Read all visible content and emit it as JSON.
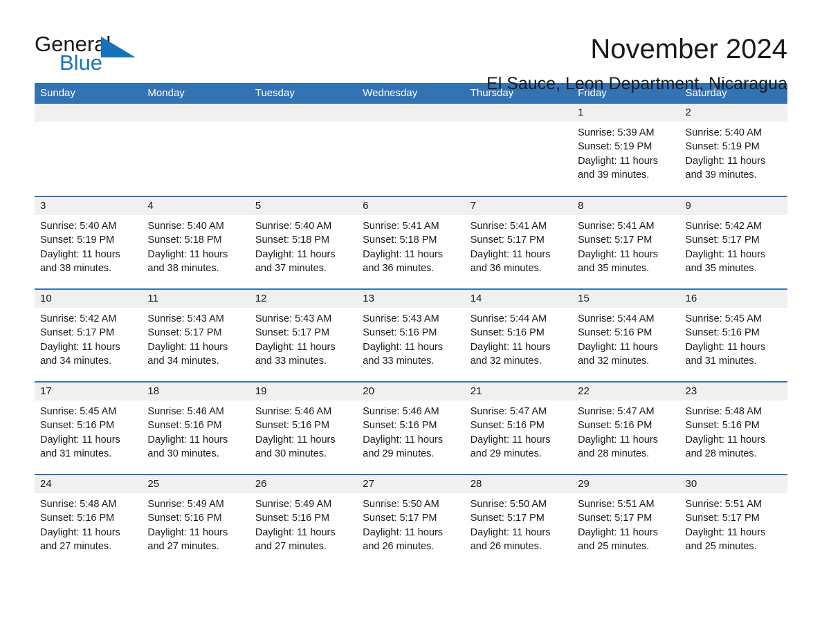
{
  "brand": {
    "name_part1": "General",
    "name_part2": "Blue",
    "triangle_color": "#1474bb",
    "accent_color": "#3273b4"
  },
  "header": {
    "month_title": "November 2024",
    "location": "El Sauce, Leon Department, Nicaragua"
  },
  "weekday_headers": [
    "Sunday",
    "Monday",
    "Tuesday",
    "Wednesday",
    "Thursday",
    "Friday",
    "Saturday"
  ],
  "weeks": [
    [
      {
        "day": "",
        "sunrise": "",
        "sunset": "",
        "daylight_line1": "",
        "daylight_line2": ""
      },
      {
        "day": "",
        "sunrise": "",
        "sunset": "",
        "daylight_line1": "",
        "daylight_line2": ""
      },
      {
        "day": "",
        "sunrise": "",
        "sunset": "",
        "daylight_line1": "",
        "daylight_line2": ""
      },
      {
        "day": "",
        "sunrise": "",
        "sunset": "",
        "daylight_line1": "",
        "daylight_line2": ""
      },
      {
        "day": "",
        "sunrise": "",
        "sunset": "",
        "daylight_line1": "",
        "daylight_line2": ""
      },
      {
        "day": "1",
        "sunrise": "Sunrise: 5:39 AM",
        "sunset": "Sunset: 5:19 PM",
        "daylight_line1": "Daylight: 11 hours",
        "daylight_line2": "and 39 minutes."
      },
      {
        "day": "2",
        "sunrise": "Sunrise: 5:40 AM",
        "sunset": "Sunset: 5:19 PM",
        "daylight_line1": "Daylight: 11 hours",
        "daylight_line2": "and 39 minutes."
      }
    ],
    [
      {
        "day": "3",
        "sunrise": "Sunrise: 5:40 AM",
        "sunset": "Sunset: 5:19 PM",
        "daylight_line1": "Daylight: 11 hours",
        "daylight_line2": "and 38 minutes."
      },
      {
        "day": "4",
        "sunrise": "Sunrise: 5:40 AM",
        "sunset": "Sunset: 5:18 PM",
        "daylight_line1": "Daylight: 11 hours",
        "daylight_line2": "and 38 minutes."
      },
      {
        "day": "5",
        "sunrise": "Sunrise: 5:40 AM",
        "sunset": "Sunset: 5:18 PM",
        "daylight_line1": "Daylight: 11 hours",
        "daylight_line2": "and 37 minutes."
      },
      {
        "day": "6",
        "sunrise": "Sunrise: 5:41 AM",
        "sunset": "Sunset: 5:18 PM",
        "daylight_line1": "Daylight: 11 hours",
        "daylight_line2": "and 36 minutes."
      },
      {
        "day": "7",
        "sunrise": "Sunrise: 5:41 AM",
        "sunset": "Sunset: 5:17 PM",
        "daylight_line1": "Daylight: 11 hours",
        "daylight_line2": "and 36 minutes."
      },
      {
        "day": "8",
        "sunrise": "Sunrise: 5:41 AM",
        "sunset": "Sunset: 5:17 PM",
        "daylight_line1": "Daylight: 11 hours",
        "daylight_line2": "and 35 minutes."
      },
      {
        "day": "9",
        "sunrise": "Sunrise: 5:42 AM",
        "sunset": "Sunset: 5:17 PM",
        "daylight_line1": "Daylight: 11 hours",
        "daylight_line2": "and 35 minutes."
      }
    ],
    [
      {
        "day": "10",
        "sunrise": "Sunrise: 5:42 AM",
        "sunset": "Sunset: 5:17 PM",
        "daylight_line1": "Daylight: 11 hours",
        "daylight_line2": "and 34 minutes."
      },
      {
        "day": "11",
        "sunrise": "Sunrise: 5:43 AM",
        "sunset": "Sunset: 5:17 PM",
        "daylight_line1": "Daylight: 11 hours",
        "daylight_line2": "and 34 minutes."
      },
      {
        "day": "12",
        "sunrise": "Sunrise: 5:43 AM",
        "sunset": "Sunset: 5:17 PM",
        "daylight_line1": "Daylight: 11 hours",
        "daylight_line2": "and 33 minutes."
      },
      {
        "day": "13",
        "sunrise": "Sunrise: 5:43 AM",
        "sunset": "Sunset: 5:16 PM",
        "daylight_line1": "Daylight: 11 hours",
        "daylight_line2": "and 33 minutes."
      },
      {
        "day": "14",
        "sunrise": "Sunrise: 5:44 AM",
        "sunset": "Sunset: 5:16 PM",
        "daylight_line1": "Daylight: 11 hours",
        "daylight_line2": "and 32 minutes."
      },
      {
        "day": "15",
        "sunrise": "Sunrise: 5:44 AM",
        "sunset": "Sunset: 5:16 PM",
        "daylight_line1": "Daylight: 11 hours",
        "daylight_line2": "and 32 minutes."
      },
      {
        "day": "16",
        "sunrise": "Sunrise: 5:45 AM",
        "sunset": "Sunset: 5:16 PM",
        "daylight_line1": "Daylight: 11 hours",
        "daylight_line2": "and 31 minutes."
      }
    ],
    [
      {
        "day": "17",
        "sunrise": "Sunrise: 5:45 AM",
        "sunset": "Sunset: 5:16 PM",
        "daylight_line1": "Daylight: 11 hours",
        "daylight_line2": "and 31 minutes."
      },
      {
        "day": "18",
        "sunrise": "Sunrise: 5:46 AM",
        "sunset": "Sunset: 5:16 PM",
        "daylight_line1": "Daylight: 11 hours",
        "daylight_line2": "and 30 minutes."
      },
      {
        "day": "19",
        "sunrise": "Sunrise: 5:46 AM",
        "sunset": "Sunset: 5:16 PM",
        "daylight_line1": "Daylight: 11 hours",
        "daylight_line2": "and 30 minutes."
      },
      {
        "day": "20",
        "sunrise": "Sunrise: 5:46 AM",
        "sunset": "Sunset: 5:16 PM",
        "daylight_line1": "Daylight: 11 hours",
        "daylight_line2": "and 29 minutes."
      },
      {
        "day": "21",
        "sunrise": "Sunrise: 5:47 AM",
        "sunset": "Sunset: 5:16 PM",
        "daylight_line1": "Daylight: 11 hours",
        "daylight_line2": "and 29 minutes."
      },
      {
        "day": "22",
        "sunrise": "Sunrise: 5:47 AM",
        "sunset": "Sunset: 5:16 PM",
        "daylight_line1": "Daylight: 11 hours",
        "daylight_line2": "and 28 minutes."
      },
      {
        "day": "23",
        "sunrise": "Sunrise: 5:48 AM",
        "sunset": "Sunset: 5:16 PM",
        "daylight_line1": "Daylight: 11 hours",
        "daylight_line2": "and 28 minutes."
      }
    ],
    [
      {
        "day": "24",
        "sunrise": "Sunrise: 5:48 AM",
        "sunset": "Sunset: 5:16 PM",
        "daylight_line1": "Daylight: 11 hours",
        "daylight_line2": "and 27 minutes."
      },
      {
        "day": "25",
        "sunrise": "Sunrise: 5:49 AM",
        "sunset": "Sunset: 5:16 PM",
        "daylight_line1": "Daylight: 11 hours",
        "daylight_line2": "and 27 minutes."
      },
      {
        "day": "26",
        "sunrise": "Sunrise: 5:49 AM",
        "sunset": "Sunset: 5:16 PM",
        "daylight_line1": "Daylight: 11 hours",
        "daylight_line2": "and 27 minutes."
      },
      {
        "day": "27",
        "sunrise": "Sunrise: 5:50 AM",
        "sunset": "Sunset: 5:17 PM",
        "daylight_line1": "Daylight: 11 hours",
        "daylight_line2": "and 26 minutes."
      },
      {
        "day": "28",
        "sunrise": "Sunrise: 5:50 AM",
        "sunset": "Sunset: 5:17 PM",
        "daylight_line1": "Daylight: 11 hours",
        "daylight_line2": "and 26 minutes."
      },
      {
        "day": "29",
        "sunrise": "Sunrise: 5:51 AM",
        "sunset": "Sunset: 5:17 PM",
        "daylight_line1": "Daylight: 11 hours",
        "daylight_line2": "and 25 minutes."
      },
      {
        "day": "30",
        "sunrise": "Sunrise: 5:51 AM",
        "sunset": "Sunset: 5:17 PM",
        "daylight_line1": "Daylight: 11 hours",
        "daylight_line2": "and 25 minutes."
      }
    ]
  ]
}
